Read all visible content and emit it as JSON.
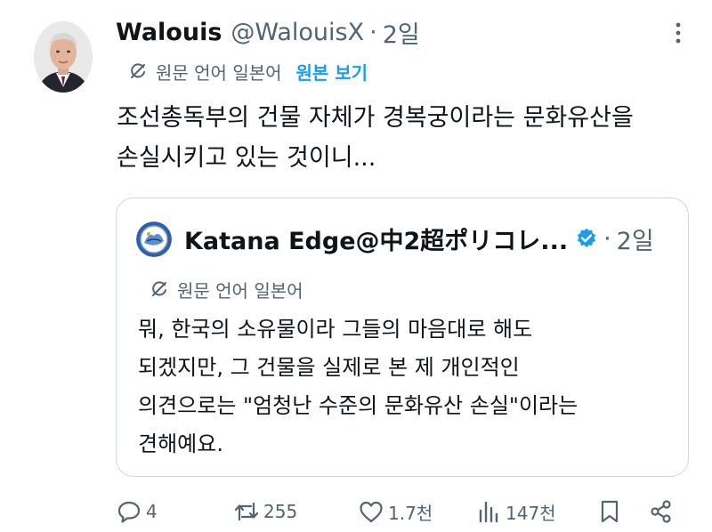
{
  "author": {
    "name": "Walouis",
    "handle": "@WalouisX",
    "separator": "·",
    "time": "2일"
  },
  "translation": {
    "notice": "원문 언어 일본어",
    "view_original": "원본 보기"
  },
  "post": {
    "line1": "조선총독부의 건물 자체가 경복궁이라는 문화유산을",
    "line2": "손실시키고 있는 것이니..."
  },
  "quote": {
    "name": "Katana Edge@中2超ポリコレ...",
    "separator": "·",
    "time": "2일",
    "translation_notice": "원문 언어 일본어",
    "lines": [
      "뭐, 한국의 소유물이라 그들의 마음대로 해도",
      "되겠지만, 그 건물을 실제로 본 제 개인적인",
      "의견으로는 \"엄청난 수준의 문화유산 손실\"이라는",
      "견해예요."
    ]
  },
  "actions": {
    "replies": "4",
    "reposts": "255",
    "likes": "1.7천",
    "views": "147천"
  },
  "colors": {
    "text": "#0f1419",
    "muted": "#536471",
    "accent": "#1d9bf0",
    "border": "#cfd9de"
  },
  "icons": [
    "more-icon",
    "translate-icon",
    "verified-badge-icon",
    "reply-icon",
    "repost-icon",
    "like-icon",
    "views-icon",
    "bookmark-icon",
    "share-icon"
  ]
}
